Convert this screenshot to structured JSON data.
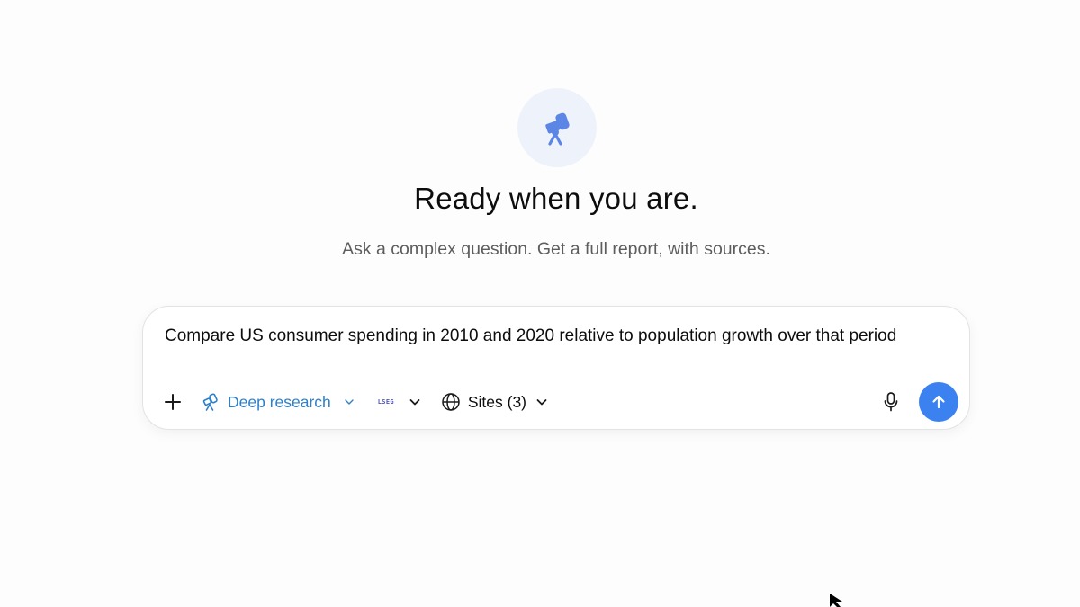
{
  "hero": {
    "icon": "telescope-icon",
    "title": "Ready when you are.",
    "subtitle": "Ask a complex question. Get a full report, with sources."
  },
  "composer": {
    "text": "Compare US consumer spending in 2010 and 2020 relative to population growth over that period",
    "toolbar": {
      "add_icon": "plus-icon",
      "mode": {
        "icon": "telescope-icon",
        "label": "Deep research"
      },
      "model": {
        "label": "LSEG"
      },
      "sites": {
        "icon": "globe-icon",
        "label": "Sites (3)"
      },
      "mic_icon": "microphone-icon",
      "send_icon": "arrow-up-icon"
    }
  },
  "colors": {
    "accent": "#3b82f0",
    "mode_text": "#2e80c9",
    "hero_bg": "#eef2fb",
    "hero_icon": "#5b86e5"
  }
}
